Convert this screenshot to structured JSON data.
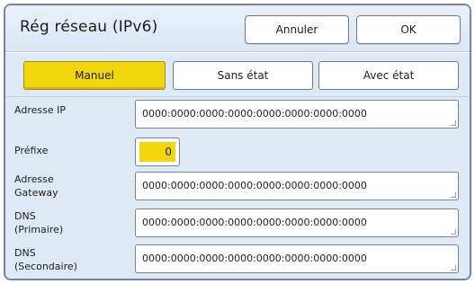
{
  "header": {
    "title": "Rég réseau (IPv6)",
    "cancel_label": "Annuler",
    "ok_label": "OK"
  },
  "modes": {
    "manual": "Manuel",
    "stateless": "Sans état",
    "stateful": "Avec état",
    "selected": "Manuel"
  },
  "fields": {
    "ip_label": "Adresse IP",
    "ip_value": "0000:0000:0000:0000:0000:0000:0000:0000",
    "prefix_label": "Préfixe",
    "prefix_value": "0",
    "gateway_label_1": "Adresse",
    "gateway_label_2": "Gateway",
    "gateway_value": "0000:0000:0000:0000:0000:0000:0000:0000",
    "dns1_label_1": "DNS",
    "dns1_label_2": "(Primaire)",
    "dns1_value": "0000:0000:0000:0000:0000:0000:0000:0000",
    "dns2_label_1": "DNS",
    "dns2_label_2": "(Secondaire)",
    "dns2_value": "0000:0000:0000:0000:0000:0000:0000:0000"
  },
  "colors": {
    "accent_yellow": "#f2d60d",
    "panel_blue": "#dde9f5",
    "frame_border": "#6f84a8"
  }
}
